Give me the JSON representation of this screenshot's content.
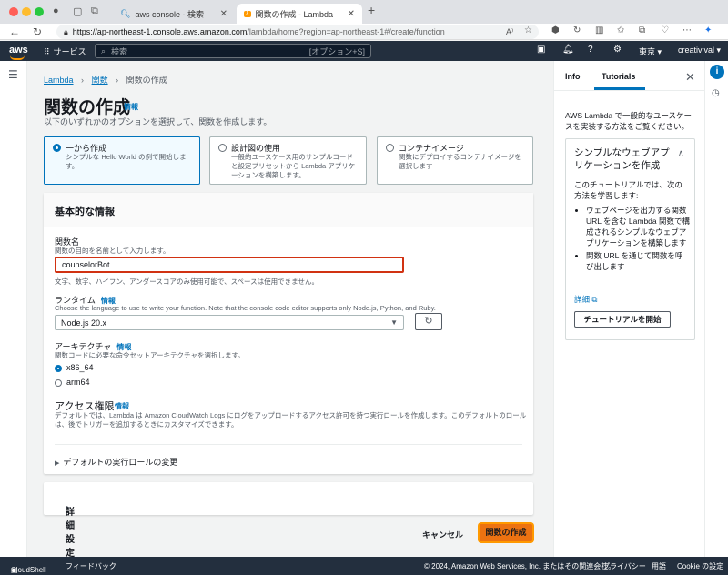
{
  "browser": {
    "tabs": [
      {
        "label": "aws console - 検索"
      },
      {
        "label": "関数の作成 - Lambda"
      }
    ],
    "url_host": "https://ap-northeast-1.console.aws.amazon.com",
    "url_path": "/lambda/home?region=ap-northeast-1#/create/function",
    "new_tab_glyph": "+"
  },
  "aws_header": {
    "logo": "aws",
    "services": "サービス",
    "search_placeholder": "検索",
    "search_shortcut": "[オプション+S]",
    "region": "東京 ▾",
    "account": "creativival ▾"
  },
  "breadcrumb": {
    "root": "Lambda",
    "parent": "関数",
    "current": "関数の作成"
  },
  "page": {
    "title": "関数の作成",
    "title_info": "情報",
    "subtitle": "以下のいずれかのオプションを選択して、関数を作成します。"
  },
  "options": [
    {
      "title": "一から作成",
      "desc": "シンプルな Hello World の例で開始します。",
      "selected": true
    },
    {
      "title": "設計図の使用",
      "desc": "一般的ユースケース用のサンプルコードと設定プリセットから Lambda アプリケーションを構築します。",
      "selected": false
    },
    {
      "title": "コンテナイメージ",
      "desc": "関数にデプロイするコンテナイメージを選択します",
      "selected": false
    }
  ],
  "basic": {
    "header": "基本的な情報",
    "fn_name_label": "関数名",
    "fn_name_desc": "関数の目的を名前として入力します。",
    "fn_name_value": "counselorBot",
    "fn_name_constraint": "文字、数字、ハイフン、アンダースコアのみ使用可能で、スペースは使用できません。",
    "runtime_label": "ランタイム",
    "runtime_info": "情報",
    "runtime_desc": "Choose the language to use to write your function. Note that the console code editor supports only Node.js, Python, and Ruby.",
    "runtime_value": "Node.js 20.x",
    "arch_label": "アーキテクチャ",
    "arch_info": "情報",
    "arch_desc": "関数コードに必要な命令セットアーキテクチャを選択します。",
    "arch_options": [
      "x86_64",
      "arm64"
    ],
    "access_title": "アクセス権限",
    "access_info": "情報",
    "access_desc": "デフォルトでは、Lambda は Amazon CloudWatch Logs にログをアップロードするアクセス許可を持つ実行ロールを作成します。このデフォルトのロールは、後でトリガーを追加するときにカスタマイズできます。",
    "exec_role": "デフォルトの実行ロールの変更"
  },
  "advanced": {
    "label": "詳細設定"
  },
  "actions": {
    "cancel": "キャンセル",
    "create": "関数の作成"
  },
  "help_panel": {
    "tab_info": "Info",
    "tab_tutorials": "Tutorials",
    "intro": "AWS Lambda で一般的なユースケースを実装する方法をご覧ください。",
    "card_title": "シンプルなウェブアプリケーションを作成",
    "card_body": "このチュートリアルでは、次の方法を学習します:",
    "bullets": [
      "ウェブページを出力する関数 URL を含む Lambda 関数で構成されるシンプルなウェブアプリケーションを構築します",
      "関数 URL を通じて関数を呼び出します"
    ],
    "learn_more": "詳細",
    "start_button": "チュートリアルを開始"
  },
  "footer": {
    "cloudshell": "CloudShell",
    "feedback": "フィードバック",
    "copyright": "© 2024, Amazon Web Services, Inc. またはその関連会社。",
    "privacy": "プライバシー",
    "terms": "用語",
    "cookies": "Cookie の設定"
  }
}
